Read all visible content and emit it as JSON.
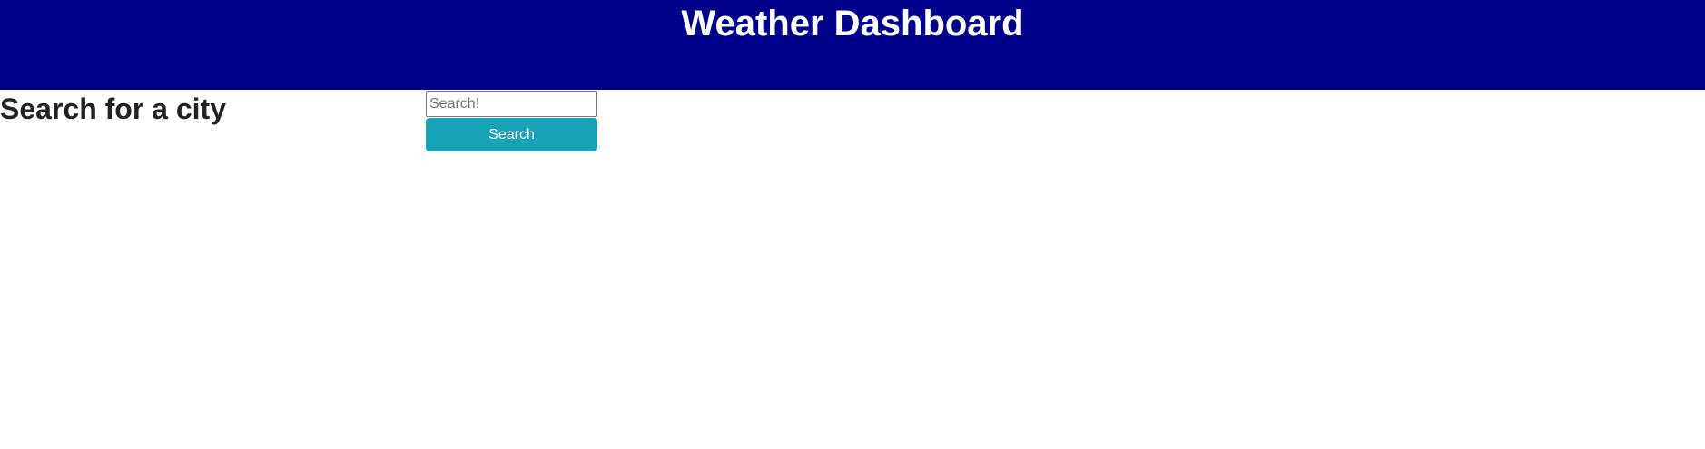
{
  "header": {
    "title": "Weather Dashboard",
    "background_color": "#00008b"
  },
  "search": {
    "heading": "Search for a city",
    "input_value": "",
    "input_placeholder": "Search!",
    "button_label": "Search",
    "button_color": "#17a2b8"
  }
}
